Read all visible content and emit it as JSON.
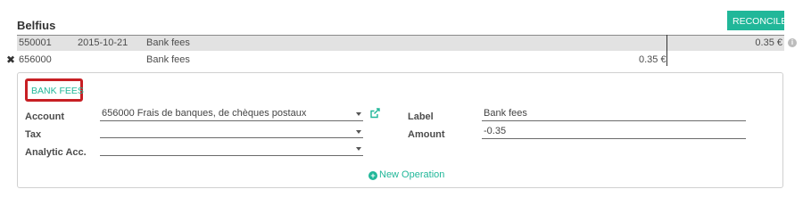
{
  "header": {
    "title": "Belfius",
    "reconcile_label": "RECONCILE"
  },
  "rows": [
    {
      "code": "550001",
      "date": "2015-10-21",
      "label": "Bank fees",
      "debit": "",
      "credit": "0.35 €"
    },
    {
      "code": "656000",
      "date": "",
      "label": "Bank fees",
      "debit": "0.35 €",
      "credit": ""
    }
  ],
  "icons": {
    "remove": "close-icon",
    "info": "info-icon",
    "external": "external-link-icon",
    "add": "plus-circle-icon"
  },
  "panel": {
    "preset_button": "BANK FEES",
    "account_label": "Account",
    "account_value": "656000 Frais de banques, de chèques postaux",
    "tax_label": "Tax",
    "tax_value": "",
    "analytic_label": "Analytic Acc.",
    "analytic_value": "",
    "label_label": "Label",
    "label_value": "Bank fees",
    "amount_label": "Amount",
    "amount_value": "-0.35",
    "new_operation": "New Operation"
  },
  "colors": {
    "accent": "#21b799",
    "highlight_border": "#c71f24",
    "row_selected": "#e2e2e2"
  }
}
